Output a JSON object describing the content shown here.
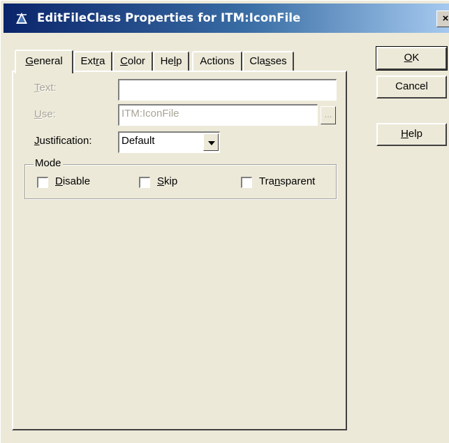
{
  "window": {
    "title": "EditFileClass Properties for ITM:IconFile",
    "close_glyph": "×"
  },
  "tabs": [
    {
      "pre": "",
      "u": "G",
      "post": "eneral",
      "active": true
    },
    {
      "pre": "Ext",
      "u": "r",
      "post": "a",
      "active": false
    },
    {
      "pre": "",
      "u": "C",
      "post": "olor",
      "active": false
    },
    {
      "pre": "He",
      "u": "l",
      "post": "p",
      "active": false
    },
    {
      "pre": "Actions",
      "u": "",
      "post": "",
      "active": false
    },
    {
      "pre": "Cla",
      "u": "s",
      "post": "ses",
      "active": false
    }
  ],
  "form": {
    "text_label": {
      "u": "T",
      "post": "ext:"
    },
    "text_value": "",
    "use_label": {
      "u": "U",
      "post": "se:"
    },
    "use_value": "ITM:IconFile",
    "use_button": "...",
    "justification_label": {
      "u": "J",
      "post": "ustification:"
    },
    "justification_value": "Default"
  },
  "mode": {
    "legend": "Mode",
    "checkboxes": [
      {
        "pre": "",
        "u": "D",
        "post": "isable",
        "checked": false
      },
      {
        "pre": "",
        "u": "S",
        "post": "kip",
        "checked": false
      },
      {
        "pre": "Tra",
        "u": "n",
        "post": "sparent",
        "checked": false
      }
    ]
  },
  "buttons": {
    "ok": {
      "u": "O",
      "post": "K"
    },
    "cancel": "Cancel",
    "help": {
      "u": "H",
      "post": "elp"
    }
  }
}
